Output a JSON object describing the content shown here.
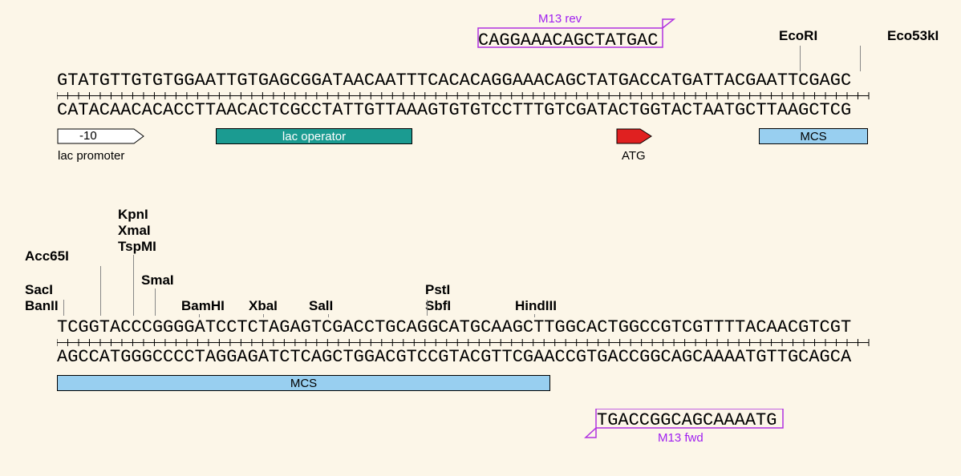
{
  "row1": {
    "top_seq": "GTATGTTGTGTGGAATTGTGAGCGGATAACAATTTCACACAGGAAACAGCTATGACCATGATTACGAATTCGAGC",
    "bot_seq": "CATACAACACACCTTAACACTCGCCTATTGTTAAAGTGTGTCCTTTGTCGATACTGGTACTAATGCTTAAGCTCG"
  },
  "row2": {
    "top_seq": "TCGGTACCCGGGGATCCTCTAGAGTCGACCTGCAGGCATGCAAGCTTGGCACTGGCCGTCGTTTTACAACGTCGT",
    "bot_seq": "AGCCATGGGCCCCTAGGAGATCTCAGCTGGACGTCCGTACGTTCGAACCGTGACCGGCAGCAAAATGTTGCAGCA"
  },
  "primers": {
    "m13_rev": {
      "label": "M13 rev",
      "seq": "CAGGAAACAGCTATGAC"
    },
    "m13_fwd": {
      "label": "M13 fwd",
      "seq": "TGACCGGCAGCAAAATG"
    }
  },
  "features": {
    "lac_promoter_text": "-10",
    "lac_promoter_label": "lac promoter",
    "lac_operator": "lac operator",
    "atg": "ATG",
    "mcs": "MCS"
  },
  "enzymes_row1": {
    "ecori": "EcoRI",
    "eco53ki": "Eco53kI"
  },
  "enzymes_row2": {
    "saci": "SacI",
    "banii": "BanII",
    "acc65i": "Acc65I",
    "kpni": "KpnI",
    "xmai": "XmaI",
    "tspmi": "TspMI",
    "smai": "SmaI",
    "bamhi": "BamHI",
    "xbai": "XbaI",
    "sali": "SalI",
    "psti": "PstI",
    "sbfi": "SbfI",
    "hindiii": "HindIII"
  }
}
